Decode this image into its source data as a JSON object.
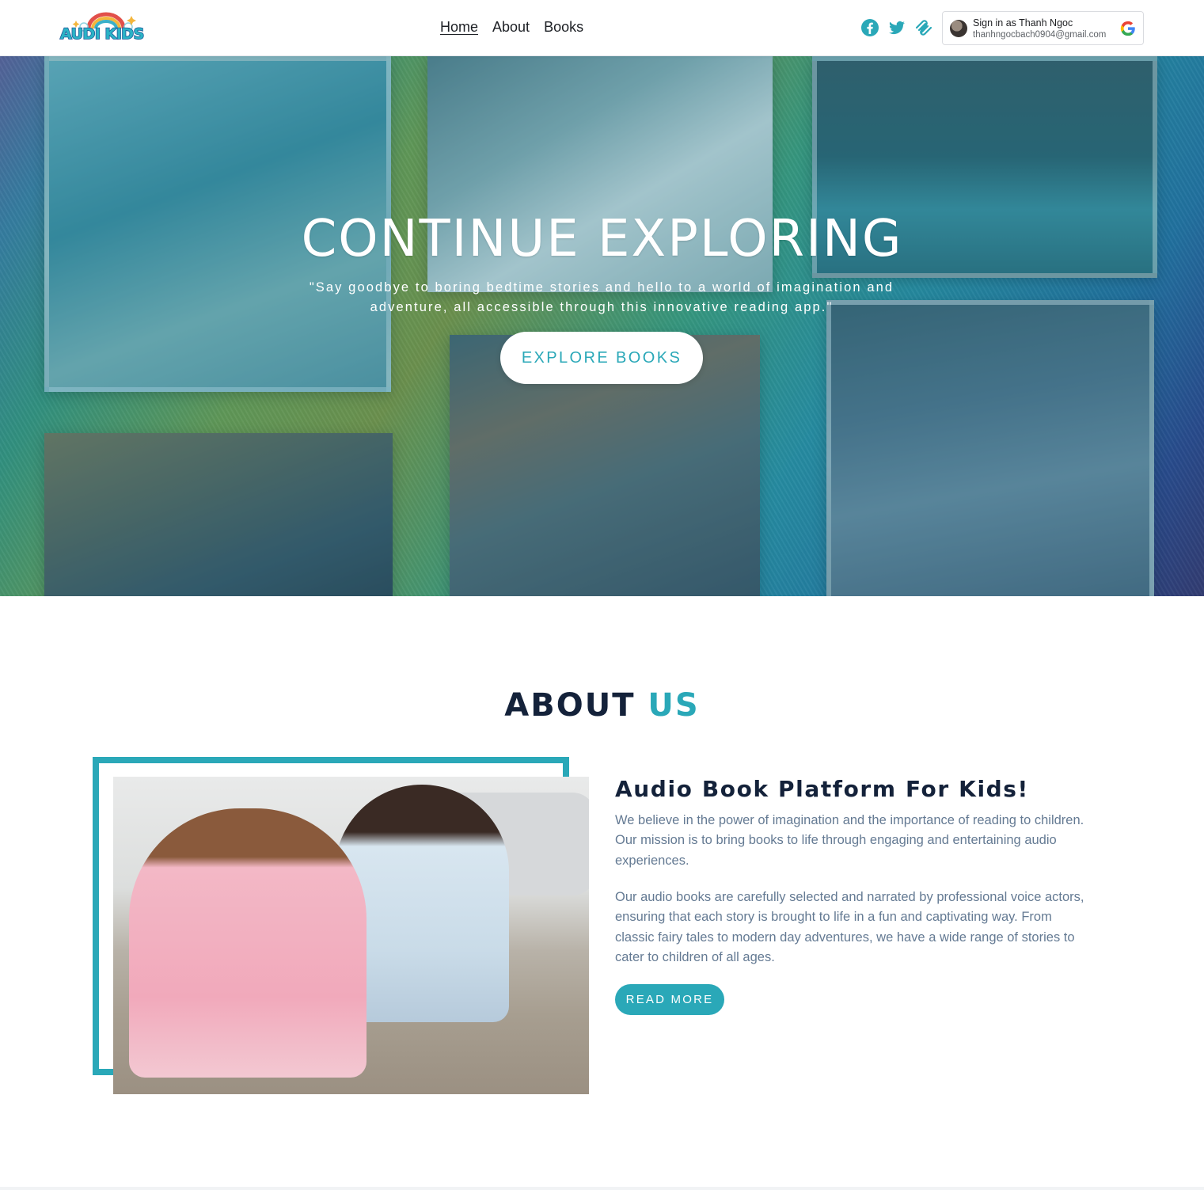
{
  "header": {
    "logo_text": "AUDI KIDS",
    "nav": [
      {
        "label": "Home",
        "active": true
      },
      {
        "label": "About",
        "active": false
      },
      {
        "label": "Books",
        "active": false
      }
    ],
    "socials": [
      "facebook-icon",
      "twitter-icon",
      "squarespace-icon"
    ],
    "signin": {
      "title": "Sign in as Thanh Ngoc",
      "email": "thanhngocbach0904@gmail.com",
      "icon": "google-icon"
    }
  },
  "hero": {
    "title": "CONTINUE EXPLORING",
    "subtitle": "\"Say goodbye to boring bedtime stories and hello to a world of imagination and adventure, all accessible through this innovative reading app.\"",
    "button_label": "EXPLORE BOOKS"
  },
  "about": {
    "title_main": "ABOUT",
    "title_accent": "US",
    "heading": "Audio Book Platform For Kids!",
    "paragraph_1": "We believe in the power of imagination and the importance of reading to children. Our mission is to bring books to life through engaging and entertaining audio experiences.",
    "paragraph_2": "Our audio books are carefully selected and narrated by professional voice actors, ensuring that each story is brought to life in a fun and captivating way. From classic fairy tales to modern day adventures, we have a wide range of stories to cater to children of all ages.",
    "button_label": "READ MORE"
  },
  "colors": {
    "accent": "#2aa8b8",
    "heading": "#14223a",
    "body_text": "#647a93"
  }
}
